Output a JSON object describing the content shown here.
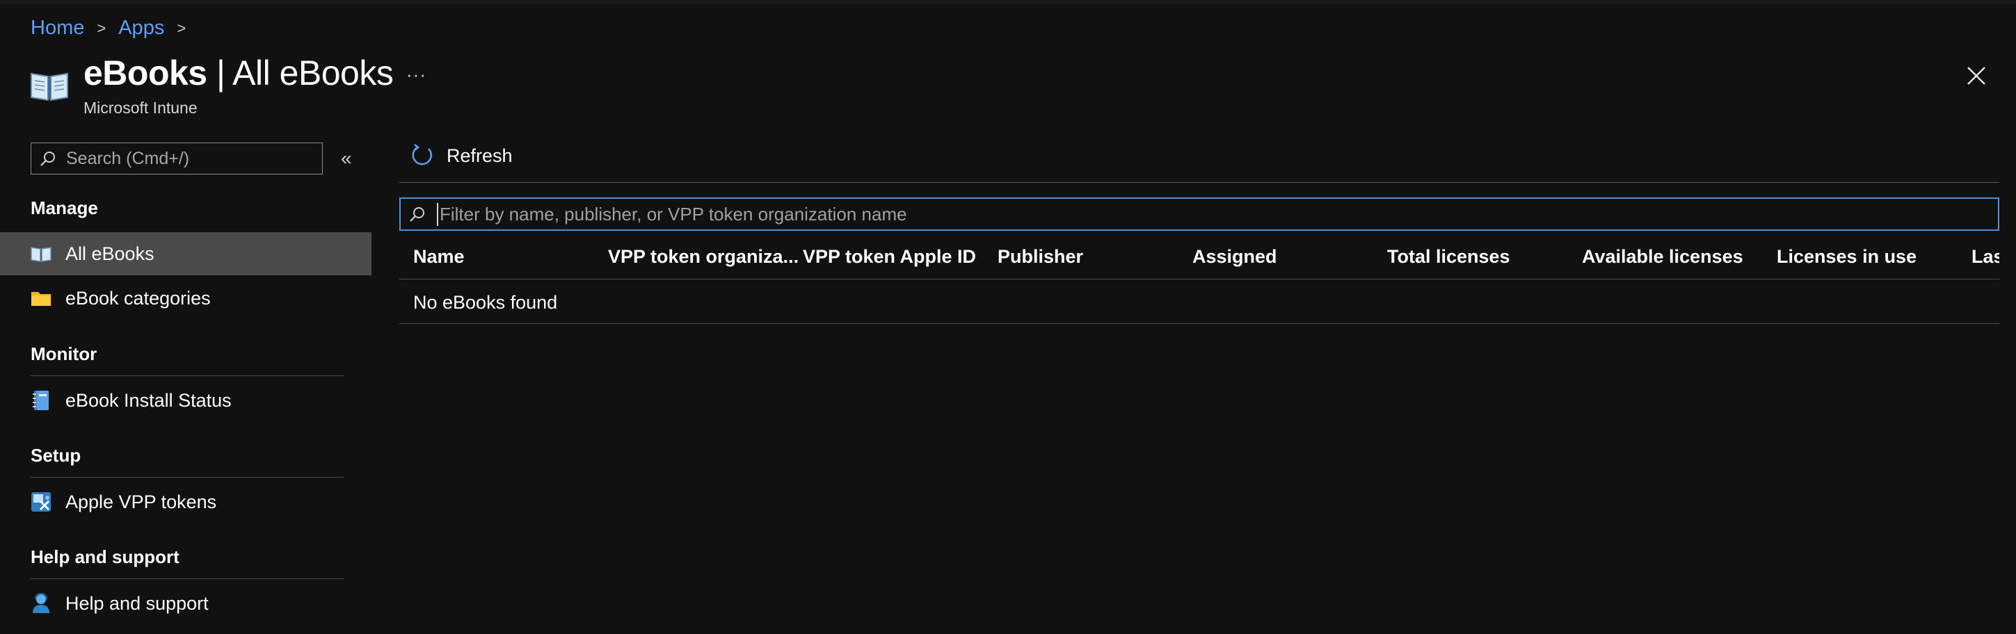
{
  "breadcrumb": [
    "Home",
    "Apps"
  ],
  "header": {
    "title_bold": "eBooks",
    "title_rest": " | All eBooks",
    "subtitle": "Microsoft Intune",
    "more": "···"
  },
  "sidebar": {
    "search_placeholder": "Search (Cmd+/)",
    "collapse": "«",
    "sections": {
      "manage": "Manage",
      "monitor": "Monitor",
      "setup": "Setup",
      "help": "Help and support"
    },
    "items": [
      {
        "label": "All eBooks",
        "icon": "book-icon",
        "selected": true
      },
      {
        "label": "eBook categories",
        "icon": "folder-icon",
        "selected": false
      },
      {
        "label": "eBook Install Status",
        "icon": "notebook-icon",
        "selected": false
      },
      {
        "label": "Apple VPP tokens",
        "icon": "vpp-token-icon",
        "selected": false
      },
      {
        "label": "Help and support",
        "icon": "support-person-icon",
        "selected": false
      }
    ]
  },
  "toolbar": {
    "refresh_label": "Refresh"
  },
  "filter": {
    "placeholder": "Filter by name, publisher, or VPP token organization name"
  },
  "table": {
    "columns": [
      "Name",
      "VPP token organiza...",
      "VPP token Apple ID",
      "Publisher",
      "Assigned",
      "Total licenses",
      "Available licenses",
      "Licenses in use",
      "Last"
    ],
    "empty_message": "No eBooks found"
  },
  "colors": {
    "background": "#111111",
    "link": "#5aa0f5",
    "selected_row": "#4a4a4a",
    "accent_border": "#4f8fd4"
  }
}
